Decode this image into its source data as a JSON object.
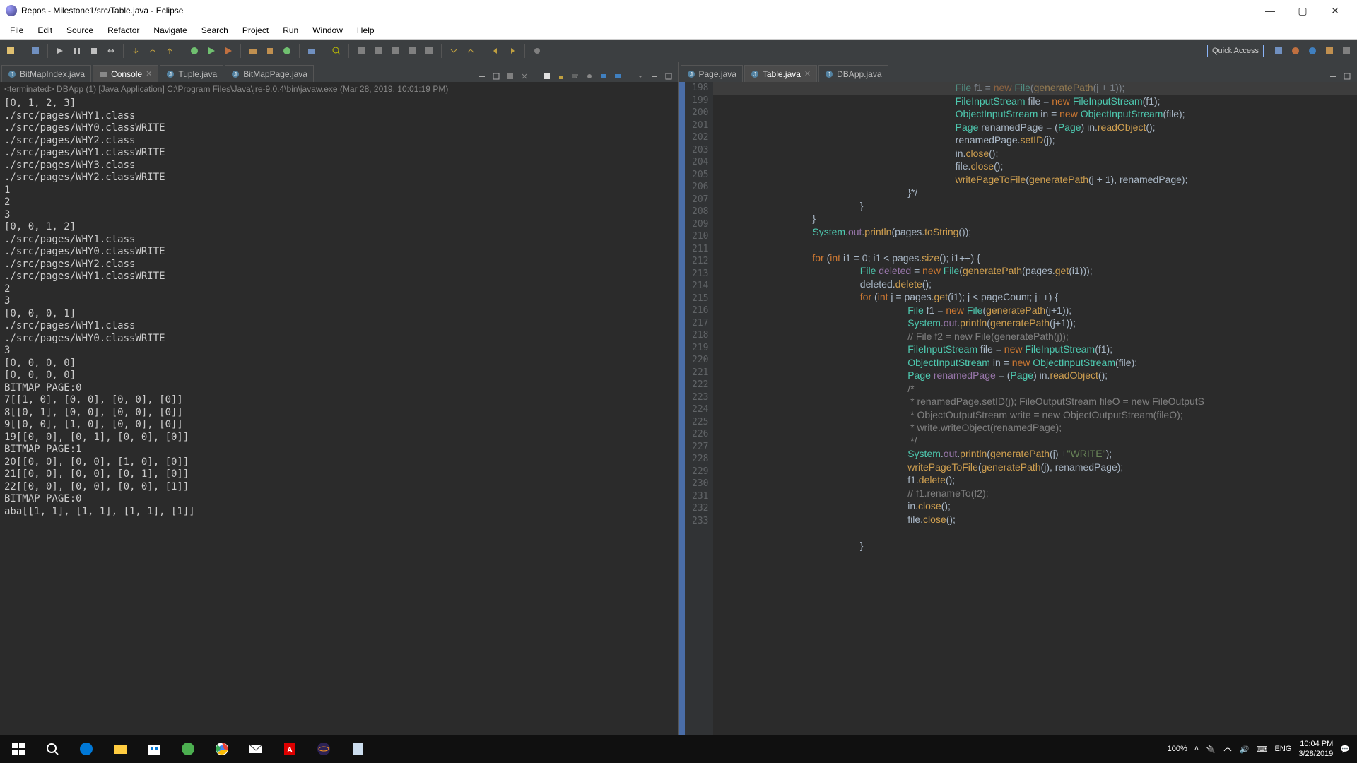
{
  "window": {
    "title": "Repos - Milestone1/src/Table.java - Eclipse"
  },
  "menu": [
    "File",
    "Edit",
    "Source",
    "Refactor",
    "Navigate",
    "Search",
    "Project",
    "Run",
    "Window",
    "Help"
  ],
  "quick_access": "Quick Access",
  "left": {
    "tabs": [
      {
        "label": "BitMapIndex.java",
        "active": false,
        "icon": "java"
      },
      {
        "label": "Console",
        "active": true,
        "icon": "console",
        "close": true
      },
      {
        "label": "Tuple.java",
        "active": false,
        "icon": "java"
      },
      {
        "label": "BitMapPage.java",
        "active": false,
        "icon": "java"
      }
    ],
    "terminated": "<terminated> DBApp (1) [Java Application] C:\\Program Files\\Java\\jre-9.0.4\\bin\\javaw.exe (Mar 28, 2019, 10:01:19 PM)",
    "console_output": "[0, 1, 2, 3]\n./src/pages/WHY1.class\n./src/pages/WHY0.classWRITE\n./src/pages/WHY2.class\n./src/pages/WHY1.classWRITE\n./src/pages/WHY3.class\n./src/pages/WHY2.classWRITE\n1\n2\n3\n[0, 0, 1, 2]\n./src/pages/WHY1.class\n./src/pages/WHY0.classWRITE\n./src/pages/WHY2.class\n./src/pages/WHY1.classWRITE\n2\n3\n[0, 0, 0, 1]\n./src/pages/WHY1.class\n./src/pages/WHY0.classWRITE\n3\n[0, 0, 0, 0]\n[0, 0, 0, 0]\nBITMAP PAGE:0\n7[[1, 0], [0, 0], [0, 0], [0]]\n8[[0, 1], [0, 0], [0, 0], [0]]\n9[[0, 0], [1, 0], [0, 0], [0]]\n19[[0, 0], [0, 1], [0, 0], [0]]\nBITMAP PAGE:1\n20[[0, 0], [0, 0], [1, 0], [0]]\n21[[0, 0], [0, 0], [0, 1], [0]]\n22[[0, 0], [0, 0], [0, 0], [1]]\nBITMAP PAGE:0\naba[[1, 1], [1, 1], [1, 1], [1]]"
  },
  "right": {
    "tabs": [
      {
        "label": "Page.java",
        "active": false,
        "icon": "java"
      },
      {
        "label": "Table.java",
        "active": true,
        "icon": "java",
        "close": true
      },
      {
        "label": "DBApp.java",
        "active": false,
        "icon": "java"
      }
    ],
    "first_line": 198,
    "code_lines": [
      {
        "t": [
          {
            "c": "default",
            "s": "\t\t\t\t\t"
          },
          {
            "c": "typ",
            "s": "File"
          },
          {
            "c": "default",
            "s": " f1 = "
          },
          {
            "c": "kw",
            "s": "new"
          },
          {
            "c": "default",
            "s": " "
          },
          {
            "c": "typ",
            "s": "File"
          },
          {
            "c": "default",
            "s": "("
          },
          {
            "c": "mth",
            "s": "generatePath"
          },
          {
            "c": "default",
            "s": "(j + 1));"
          }
        ]
      },
      {
        "t": [
          {
            "c": "default",
            "s": "\t\t\t\t\t"
          },
          {
            "c": "typ",
            "s": "FileInputStream"
          },
          {
            "c": "default",
            "s": " file = "
          },
          {
            "c": "kw",
            "s": "new"
          },
          {
            "c": "default",
            "s": " "
          },
          {
            "c": "typ",
            "s": "FileInputStream"
          },
          {
            "c": "default",
            "s": "(f1);"
          }
        ]
      },
      {
        "t": [
          {
            "c": "default",
            "s": "\t\t\t\t\t"
          },
          {
            "c": "typ",
            "s": "ObjectInputStream"
          },
          {
            "c": "default",
            "s": " in = "
          },
          {
            "c": "kw",
            "s": "new"
          },
          {
            "c": "default",
            "s": " "
          },
          {
            "c": "typ",
            "s": "ObjectInputStream"
          },
          {
            "c": "default",
            "s": "(file);"
          }
        ]
      },
      {
        "t": [
          {
            "c": "default",
            "s": "\t\t\t\t\t"
          },
          {
            "c": "typ",
            "s": "Page"
          },
          {
            "c": "default",
            "s": " renamedPage = ("
          },
          {
            "c": "typ",
            "s": "Page"
          },
          {
            "c": "default",
            "s": ") in."
          },
          {
            "c": "mth",
            "s": "readObject"
          },
          {
            "c": "default",
            "s": "();"
          }
        ]
      },
      {
        "t": [
          {
            "c": "default",
            "s": "\t\t\t\t\trenamedPage."
          },
          {
            "c": "mth",
            "s": "setID"
          },
          {
            "c": "default",
            "s": "(j);"
          }
        ]
      },
      {
        "t": [
          {
            "c": "default",
            "s": "\t\t\t\t\tin."
          },
          {
            "c": "mth",
            "s": "close"
          },
          {
            "c": "default",
            "s": "();"
          }
        ]
      },
      {
        "t": [
          {
            "c": "default",
            "s": "\t\t\t\t\tfile."
          },
          {
            "c": "mth",
            "s": "close"
          },
          {
            "c": "default",
            "s": "();"
          }
        ]
      },
      {
        "t": [
          {
            "c": "default",
            "s": "\t\t\t\t\t"
          },
          {
            "c": "mth",
            "s": "writePageToFile"
          },
          {
            "c": "default",
            "s": "("
          },
          {
            "c": "mth",
            "s": "generatePath"
          },
          {
            "c": "default",
            "s": "(j + 1), renamedPage);"
          }
        ]
      },
      {
        "t": [
          {
            "c": "default",
            "s": "\t\t\t\t}*/"
          }
        ]
      },
      {
        "t": [
          {
            "c": "default",
            "s": "\t\t\t}"
          }
        ]
      },
      {
        "t": [
          {
            "c": "default",
            "s": "\t\t}"
          }
        ]
      },
      {
        "t": [
          {
            "c": "default",
            "s": "\t\t"
          },
          {
            "c": "typ",
            "s": "System"
          },
          {
            "c": "default",
            "s": "."
          },
          {
            "c": "fld",
            "s": "out"
          },
          {
            "c": "default",
            "s": "."
          },
          {
            "c": "mth",
            "s": "println"
          },
          {
            "c": "default",
            "s": "(pages."
          },
          {
            "c": "mth",
            "s": "toString"
          },
          {
            "c": "default",
            "s": "());"
          }
        ]
      },
      {
        "t": [
          {
            "c": "default",
            "s": ""
          }
        ]
      },
      {
        "t": [
          {
            "c": "default",
            "s": "\t\t"
          },
          {
            "c": "kw",
            "s": "for"
          },
          {
            "c": "default",
            "s": " ("
          },
          {
            "c": "kw",
            "s": "int"
          },
          {
            "c": "default",
            "s": " i1 = 0; i1 < pages."
          },
          {
            "c": "mth",
            "s": "size"
          },
          {
            "c": "default",
            "s": "(); i1++) {"
          }
        ]
      },
      {
        "t": [
          {
            "c": "default",
            "s": "\t\t\t"
          },
          {
            "c": "typ",
            "s": "File"
          },
          {
            "c": "default",
            "s": " "
          },
          {
            "c": "fld",
            "s": "deleted"
          },
          {
            "c": "default",
            "s": " = "
          },
          {
            "c": "kw",
            "s": "new"
          },
          {
            "c": "default",
            "s": " "
          },
          {
            "c": "typ",
            "s": "File"
          },
          {
            "c": "default",
            "s": "("
          },
          {
            "c": "mth",
            "s": "generatePath"
          },
          {
            "c": "default",
            "s": "(pages."
          },
          {
            "c": "mth",
            "s": "get"
          },
          {
            "c": "default",
            "s": "(i1)));"
          }
        ]
      },
      {
        "t": [
          {
            "c": "default",
            "s": "\t\t\tdeleted."
          },
          {
            "c": "mth",
            "s": "delete"
          },
          {
            "c": "default",
            "s": "();"
          }
        ]
      },
      {
        "t": [
          {
            "c": "default",
            "s": "\t\t\t"
          },
          {
            "c": "kw",
            "s": "for"
          },
          {
            "c": "default",
            "s": " ("
          },
          {
            "c": "kw",
            "s": "int"
          },
          {
            "c": "default",
            "s": " j = pages."
          },
          {
            "c": "mth",
            "s": "get"
          },
          {
            "c": "default",
            "s": "(i1); j < pageCount; j++) {"
          }
        ]
      },
      {
        "t": [
          {
            "c": "default",
            "s": "\t\t\t\t"
          },
          {
            "c": "typ",
            "s": "File"
          },
          {
            "c": "default",
            "s": " f1 = "
          },
          {
            "c": "kw",
            "s": "new"
          },
          {
            "c": "default",
            "s": " "
          },
          {
            "c": "typ",
            "s": "File"
          },
          {
            "c": "default",
            "s": "("
          },
          {
            "c": "mth",
            "s": "generatePath"
          },
          {
            "c": "default",
            "s": "(j+1));"
          }
        ]
      },
      {
        "t": [
          {
            "c": "default",
            "s": "\t\t\t\t"
          },
          {
            "c": "typ",
            "s": "System"
          },
          {
            "c": "default",
            "s": "."
          },
          {
            "c": "fld",
            "s": "out"
          },
          {
            "c": "default",
            "s": "."
          },
          {
            "c": "mth",
            "s": "println"
          },
          {
            "c": "default",
            "s": "("
          },
          {
            "c": "mth",
            "s": "generatePath"
          },
          {
            "c": "default",
            "s": "(j+1));"
          }
        ]
      },
      {
        "t": [
          {
            "c": "default",
            "s": "\t\t\t\t"
          },
          {
            "c": "cmt",
            "s": "// File f2 = new File(generatePath(j));"
          }
        ]
      },
      {
        "t": [
          {
            "c": "default",
            "s": "\t\t\t\t"
          },
          {
            "c": "typ",
            "s": "FileInputStream"
          },
          {
            "c": "default",
            "s": " file = "
          },
          {
            "c": "kw",
            "s": "new"
          },
          {
            "c": "default",
            "s": " "
          },
          {
            "c": "typ",
            "s": "FileInputStream"
          },
          {
            "c": "default",
            "s": "(f1);"
          }
        ]
      },
      {
        "t": [
          {
            "c": "default",
            "s": "\t\t\t\t"
          },
          {
            "c": "typ",
            "s": "ObjectInputStream"
          },
          {
            "c": "default",
            "s": " in = "
          },
          {
            "c": "kw",
            "s": "new"
          },
          {
            "c": "default",
            "s": " "
          },
          {
            "c": "typ",
            "s": "ObjectInputStream"
          },
          {
            "c": "default",
            "s": "(file);"
          }
        ]
      },
      {
        "t": [
          {
            "c": "default",
            "s": "\t\t\t\t"
          },
          {
            "c": "typ",
            "s": "Page"
          },
          {
            "c": "default",
            "s": " "
          },
          {
            "c": "fld",
            "s": "renamedPage"
          },
          {
            "c": "default",
            "s": " = ("
          },
          {
            "c": "typ",
            "s": "Page"
          },
          {
            "c": "default",
            "s": ") in."
          },
          {
            "c": "mth",
            "s": "readObject"
          },
          {
            "c": "default",
            "s": "();"
          }
        ]
      },
      {
        "t": [
          {
            "c": "default",
            "s": "\t\t\t\t"
          },
          {
            "c": "cmt",
            "s": "/*"
          }
        ]
      },
      {
        "t": [
          {
            "c": "default",
            "s": "\t\t\t\t"
          },
          {
            "c": "cmt",
            "s": " * renamedPage.setID(j); FileOutputStream fileO = new FileOutputS"
          }
        ]
      },
      {
        "t": [
          {
            "c": "default",
            "s": "\t\t\t\t"
          },
          {
            "c": "cmt",
            "s": " * ObjectOutputStream write = new ObjectOutputStream(fileO);"
          }
        ]
      },
      {
        "t": [
          {
            "c": "default",
            "s": "\t\t\t\t"
          },
          {
            "c": "cmt",
            "s": " * write.writeObject(renamedPage);"
          }
        ]
      },
      {
        "t": [
          {
            "c": "default",
            "s": "\t\t\t\t"
          },
          {
            "c": "cmt",
            "s": " */"
          }
        ]
      },
      {
        "t": [
          {
            "c": "default",
            "s": "\t\t\t\t"
          },
          {
            "c": "typ",
            "s": "System"
          },
          {
            "c": "default",
            "s": "."
          },
          {
            "c": "fld",
            "s": "out"
          },
          {
            "c": "default",
            "s": "."
          },
          {
            "c": "mth",
            "s": "println"
          },
          {
            "c": "default",
            "s": "("
          },
          {
            "c": "mth",
            "s": "generatePath"
          },
          {
            "c": "default",
            "s": "(j) +"
          },
          {
            "c": "str",
            "s": "\"WRITE\""
          },
          {
            "c": "default",
            "s": ");"
          }
        ]
      },
      {
        "t": [
          {
            "c": "default",
            "s": "\t\t\t\t"
          },
          {
            "c": "mth",
            "s": "writePageToFile"
          },
          {
            "c": "default",
            "s": "("
          },
          {
            "c": "mth",
            "s": "generatePath"
          },
          {
            "c": "default",
            "s": "(j), renamedPage);"
          }
        ]
      },
      {
        "t": [
          {
            "c": "default",
            "s": "\t\t\t\tf1."
          },
          {
            "c": "mth",
            "s": "delete"
          },
          {
            "c": "default",
            "s": "();"
          }
        ]
      },
      {
        "t": [
          {
            "c": "default",
            "s": "\t\t\t\t"
          },
          {
            "c": "cmt",
            "s": "// f1.renameTo(f2);"
          }
        ]
      },
      {
        "t": [
          {
            "c": "default",
            "s": "\t\t\t\tin."
          },
          {
            "c": "mth",
            "s": "close"
          },
          {
            "c": "default",
            "s": "();"
          }
        ]
      },
      {
        "t": [
          {
            "c": "default",
            "s": "\t\t\t\tfile."
          },
          {
            "c": "mth",
            "s": "close"
          },
          {
            "c": "default",
            "s": "();"
          }
        ]
      },
      {
        "t": [
          {
            "c": "default",
            "s": ""
          }
        ]
      },
      {
        "t": [
          {
            "c": "default",
            "s": "\t\t\t}"
          }
        ]
      }
    ]
  },
  "tray": {
    "battery": "100%",
    "lang": "ENG",
    "time": "10:04 PM",
    "date": "3/28/2019"
  }
}
